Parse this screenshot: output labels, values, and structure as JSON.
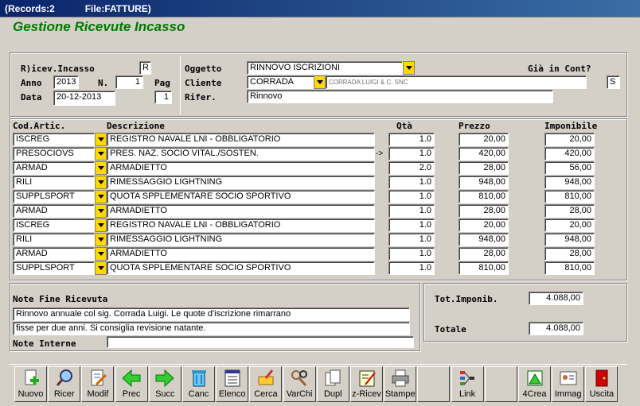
{
  "window": {
    "records": "(Records:2",
    "file": "File:FATTURE)"
  },
  "title": "Gestione Ricevute Incasso",
  "header": {
    "ricev_label": "R)icev.Incasso",
    "ricev_value": "R",
    "anno_label": "Anno",
    "anno_value": "2013",
    "n_label": "N.",
    "n_value": "1",
    "pag_label": "Pag",
    "pag_value": "1",
    "data_label": "Data",
    "data_value": "20-12-2013",
    "oggetto_label": "Oggetto",
    "oggetto_value": "RINNOVO ISCRIZIONI",
    "cliente_label": "Cliente",
    "cliente_code": "CORRADA",
    "cliente_name": "CORRADA LUIGI & C. SNC",
    "rifer_label": "Rifer.",
    "rifer_value": "Rinnovo",
    "gia_label": "Già in Cont?",
    "gia_value": "S"
  },
  "table": {
    "headers": {
      "cod": "Cod.Artic.",
      "desc": "Descrizione",
      "qta": "Qtà",
      "prezzo": "Prezzo",
      "imponibile": "Imponibile"
    },
    "marker": "->",
    "rows": [
      {
        "cod": "ISCREG",
        "desc": "REGISTRO NAVALE LNI - OBBLIGATORIO",
        "qta": "1.0",
        "prezzo": "20,00",
        "imp": "20,00"
      },
      {
        "cod": "PRESOCIOVS",
        "desc": "PRES. NAZ. SOCIO VITAL./SOSTEN.",
        "qta": "1.0",
        "prezzo": "420,00",
        "imp": "420,00"
      },
      {
        "cod": "ARMAD",
        "desc": "ARMADIETTO",
        "qta": "2.0",
        "prezzo": "28,00",
        "imp": "56,00"
      },
      {
        "cod": "RILI",
        "desc": "RIMESSAGGIO LIGHTNING",
        "qta": "1.0",
        "prezzo": "948,00",
        "imp": "948,00"
      },
      {
        "cod": "SUPPLSPORT",
        "desc": "QUOTA SPPLEMENTARE SOCIO SPORTIVO",
        "qta": "1.0",
        "prezzo": "810,00",
        "imp": "810,00"
      },
      {
        "cod": "ARMAD",
        "desc": "ARMADIETTO",
        "qta": "1.0",
        "prezzo": "28,00",
        "imp": "28,00"
      },
      {
        "cod": "ISCREG",
        "desc": "REGISTRO NAVALE LNI - OBBLIGATORIO",
        "qta": "1.0",
        "prezzo": "20,00",
        "imp": "20,00"
      },
      {
        "cod": "RILI",
        "desc": "RIMESSAGGIO LIGHTNING",
        "qta": "1.0",
        "prezzo": "948,00",
        "imp": "948,00"
      },
      {
        "cod": "ARMAD",
        "desc": "ARMADIETTO",
        "qta": "1.0",
        "prezzo": "28,00",
        "imp": "28,00"
      },
      {
        "cod": "SUPPLSPORT",
        "desc": "QUOTA SPPLEMENTARE SOCIO SPORTIVO",
        "qta": "1.0",
        "prezzo": "810,00",
        "imp": "810,00"
      }
    ]
  },
  "notes": {
    "fine_label": "Note Fine Ricevuta",
    "fine_line1": "Rinnovo annuale col sig. Corrada Luigi. Le quote d'iscrizione rimarrano",
    "fine_line2": "fisse per due anni. Si consiglia revisione natante.",
    "interne_label": "Note Interne",
    "interne_value": ""
  },
  "totals": {
    "tot_label": "Tot.Imponib.",
    "tot_value": "4.088,00",
    "totale_label": "Totale",
    "totale_value": "4.088,00"
  },
  "toolbar": [
    "Nuovo",
    "Ricer",
    "Modif",
    "Prec",
    "Succ",
    "Canc",
    "Elenco",
    "Cerca",
    "VarChi",
    "Dupl",
    "z-Ricev",
    "Stampe",
    "",
    "Link",
    "",
    "4Crea",
    "Immag",
    "Uscita"
  ]
}
